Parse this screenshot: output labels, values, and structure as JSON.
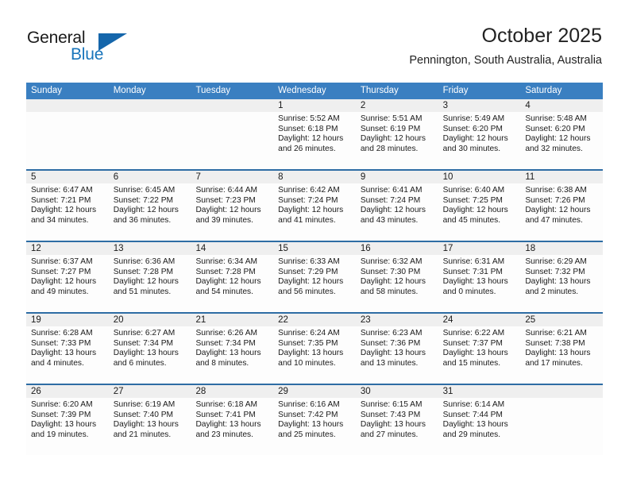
{
  "brand": {
    "name_part1": "General",
    "name_part2": "Blue",
    "accent_color": "#1975bb",
    "triangle_color": "#1566ab"
  },
  "header": {
    "title": "October 2025",
    "subtitle": "Pennington, South Australia, Australia"
  },
  "theme": {
    "header_row_bg": "#3a7fc1",
    "week_separator": "#2e6da4",
    "daynum_strip_bg": "#efefef"
  },
  "weekdays": [
    "Sunday",
    "Monday",
    "Tuesday",
    "Wednesday",
    "Thursday",
    "Friday",
    "Saturday"
  ],
  "weeks": [
    [
      {
        "day": "",
        "lines": []
      },
      {
        "day": "",
        "lines": []
      },
      {
        "day": "",
        "lines": []
      },
      {
        "day": "1",
        "lines": [
          "Sunrise: 5:52 AM",
          "Sunset: 6:18 PM",
          "Daylight: 12 hours",
          "and 26 minutes."
        ]
      },
      {
        "day": "2",
        "lines": [
          "Sunrise: 5:51 AM",
          "Sunset: 6:19 PM",
          "Daylight: 12 hours",
          "and 28 minutes."
        ]
      },
      {
        "day": "3",
        "lines": [
          "Sunrise: 5:49 AM",
          "Sunset: 6:20 PM",
          "Daylight: 12 hours",
          "and 30 minutes."
        ]
      },
      {
        "day": "4",
        "lines": [
          "Sunrise: 5:48 AM",
          "Sunset: 6:20 PM",
          "Daylight: 12 hours",
          "and 32 minutes."
        ]
      }
    ],
    [
      {
        "day": "5",
        "lines": [
          "Sunrise: 6:47 AM",
          "Sunset: 7:21 PM",
          "Daylight: 12 hours",
          "and 34 minutes."
        ]
      },
      {
        "day": "6",
        "lines": [
          "Sunrise: 6:45 AM",
          "Sunset: 7:22 PM",
          "Daylight: 12 hours",
          "and 36 minutes."
        ]
      },
      {
        "day": "7",
        "lines": [
          "Sunrise: 6:44 AM",
          "Sunset: 7:23 PM",
          "Daylight: 12 hours",
          "and 39 minutes."
        ]
      },
      {
        "day": "8",
        "lines": [
          "Sunrise: 6:42 AM",
          "Sunset: 7:24 PM",
          "Daylight: 12 hours",
          "and 41 minutes."
        ]
      },
      {
        "day": "9",
        "lines": [
          "Sunrise: 6:41 AM",
          "Sunset: 7:24 PM",
          "Daylight: 12 hours",
          "and 43 minutes."
        ]
      },
      {
        "day": "10",
        "lines": [
          "Sunrise: 6:40 AM",
          "Sunset: 7:25 PM",
          "Daylight: 12 hours",
          "and 45 minutes."
        ]
      },
      {
        "day": "11",
        "lines": [
          "Sunrise: 6:38 AM",
          "Sunset: 7:26 PM",
          "Daylight: 12 hours",
          "and 47 minutes."
        ]
      }
    ],
    [
      {
        "day": "12",
        "lines": [
          "Sunrise: 6:37 AM",
          "Sunset: 7:27 PM",
          "Daylight: 12 hours",
          "and 49 minutes."
        ]
      },
      {
        "day": "13",
        "lines": [
          "Sunrise: 6:36 AM",
          "Sunset: 7:28 PM",
          "Daylight: 12 hours",
          "and 51 minutes."
        ]
      },
      {
        "day": "14",
        "lines": [
          "Sunrise: 6:34 AM",
          "Sunset: 7:28 PM",
          "Daylight: 12 hours",
          "and 54 minutes."
        ]
      },
      {
        "day": "15",
        "lines": [
          "Sunrise: 6:33 AM",
          "Sunset: 7:29 PM",
          "Daylight: 12 hours",
          "and 56 minutes."
        ]
      },
      {
        "day": "16",
        "lines": [
          "Sunrise: 6:32 AM",
          "Sunset: 7:30 PM",
          "Daylight: 12 hours",
          "and 58 minutes."
        ]
      },
      {
        "day": "17",
        "lines": [
          "Sunrise: 6:31 AM",
          "Sunset: 7:31 PM",
          "Daylight: 13 hours",
          "and 0 minutes."
        ]
      },
      {
        "day": "18",
        "lines": [
          "Sunrise: 6:29 AM",
          "Sunset: 7:32 PM",
          "Daylight: 13 hours",
          "and 2 minutes."
        ]
      }
    ],
    [
      {
        "day": "19",
        "lines": [
          "Sunrise: 6:28 AM",
          "Sunset: 7:33 PM",
          "Daylight: 13 hours",
          "and 4 minutes."
        ]
      },
      {
        "day": "20",
        "lines": [
          "Sunrise: 6:27 AM",
          "Sunset: 7:34 PM",
          "Daylight: 13 hours",
          "and 6 minutes."
        ]
      },
      {
        "day": "21",
        "lines": [
          "Sunrise: 6:26 AM",
          "Sunset: 7:34 PM",
          "Daylight: 13 hours",
          "and 8 minutes."
        ]
      },
      {
        "day": "22",
        "lines": [
          "Sunrise: 6:24 AM",
          "Sunset: 7:35 PM",
          "Daylight: 13 hours",
          "and 10 minutes."
        ]
      },
      {
        "day": "23",
        "lines": [
          "Sunrise: 6:23 AM",
          "Sunset: 7:36 PM",
          "Daylight: 13 hours",
          "and 13 minutes."
        ]
      },
      {
        "day": "24",
        "lines": [
          "Sunrise: 6:22 AM",
          "Sunset: 7:37 PM",
          "Daylight: 13 hours",
          "and 15 minutes."
        ]
      },
      {
        "day": "25",
        "lines": [
          "Sunrise: 6:21 AM",
          "Sunset: 7:38 PM",
          "Daylight: 13 hours",
          "and 17 minutes."
        ]
      }
    ],
    [
      {
        "day": "26",
        "lines": [
          "Sunrise: 6:20 AM",
          "Sunset: 7:39 PM",
          "Daylight: 13 hours",
          "and 19 minutes."
        ]
      },
      {
        "day": "27",
        "lines": [
          "Sunrise: 6:19 AM",
          "Sunset: 7:40 PM",
          "Daylight: 13 hours",
          "and 21 minutes."
        ]
      },
      {
        "day": "28",
        "lines": [
          "Sunrise: 6:18 AM",
          "Sunset: 7:41 PM",
          "Daylight: 13 hours",
          "and 23 minutes."
        ]
      },
      {
        "day": "29",
        "lines": [
          "Sunrise: 6:16 AM",
          "Sunset: 7:42 PM",
          "Daylight: 13 hours",
          "and 25 minutes."
        ]
      },
      {
        "day": "30",
        "lines": [
          "Sunrise: 6:15 AM",
          "Sunset: 7:43 PM",
          "Daylight: 13 hours",
          "and 27 minutes."
        ]
      },
      {
        "day": "31",
        "lines": [
          "Sunrise: 6:14 AM",
          "Sunset: 7:44 PM",
          "Daylight: 13 hours",
          "and 29 minutes."
        ]
      },
      {
        "day": "",
        "lines": []
      }
    ]
  ]
}
